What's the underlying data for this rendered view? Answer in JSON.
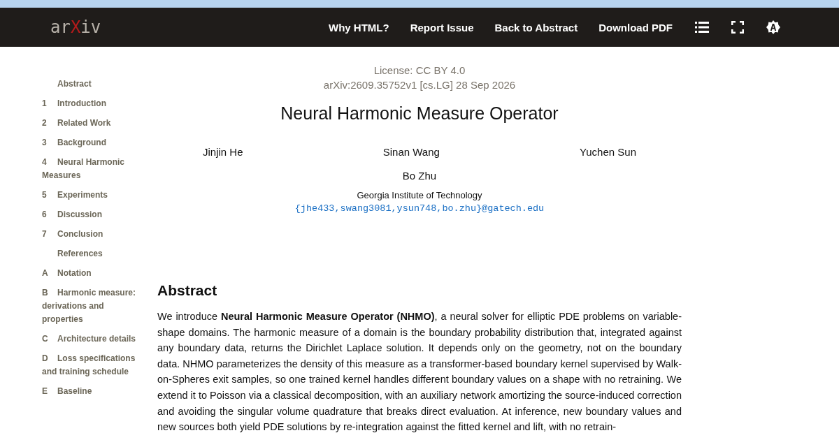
{
  "logo": [
    {
      "text": "ar",
      "kind": "plain"
    },
    {
      "text": "X",
      "kind": "accent"
    },
    {
      "text": "iv",
      "kind": "plain"
    }
  ],
  "nav": [
    {
      "label": "Why HTML?"
    },
    {
      "label": "Report Issue"
    },
    {
      "label": "Back to Abstract"
    },
    {
      "label": "Download PDF"
    }
  ],
  "toc": [
    {
      "label": "Abstract"
    },
    {
      "number": "1",
      "label": "Introduction"
    },
    {
      "number": "2",
      "label": "Related Work"
    },
    {
      "number": "3",
      "label": "Background"
    },
    {
      "number": "4",
      "label": "Neural Harmonic Measures"
    },
    {
      "number": "5",
      "label": "Experiments"
    },
    {
      "number": "6",
      "label": "Discussion"
    },
    {
      "number": "7",
      "label": "Conclusion"
    },
    {
      "label": "References"
    },
    {
      "number": "A",
      "label": "Notation"
    },
    {
      "number": "B",
      "label": "Harmonic measure: derivations and properties"
    },
    {
      "number": "C",
      "label": "Architecture details"
    },
    {
      "number": "D",
      "label": "Loss specifications and training schedule"
    },
    {
      "number": "E",
      "label": "Baseline"
    }
  ],
  "license": "License: CC BY 4.0",
  "arxiv_id": "arXiv:2609.35752v1 [cs.LG] 28 Sep 2026",
  "title": "Neural Harmonic Measure Operator",
  "authors": [
    "Jinjin He",
    "Sinan Wang",
    "Yuchen Sun"
  ],
  "last_author": "Bo Zhu",
  "affiliation": "Georgia Institute of Technology",
  "email": "{jhe433,swang3081,ysun748,bo.zhu}@gatech.edu",
  "abstract_heading": "Abstract",
  "abstract": "We introduce **Neural Harmonic Measure Operator (NHMO)**, a neural solver for elliptic PDE problems on variable-shape domains. The harmonic measure of a domain is the boundary probability distribution that, integrated against any boundary data, returns the Dirichlet Laplace solution. It depends only on the geometry, not on the boundary data. NHMO parameterizes the density of this measure as a transformer-based boundary kernel supervised by Walk-on-Spheres exit samples, so one trained kernel handles different boundary values on a shape with no retraining. We extend it to Poisson via a classical decomposition, with an auxiliary network amortizing the source-induced correction and avoiding the singular volume quadrature that breaks direct evaluation. At inference, new boundary values and new sources both yield PDE solutions by re-integration against the fitted kernel and lift, with no retrain-"
}
